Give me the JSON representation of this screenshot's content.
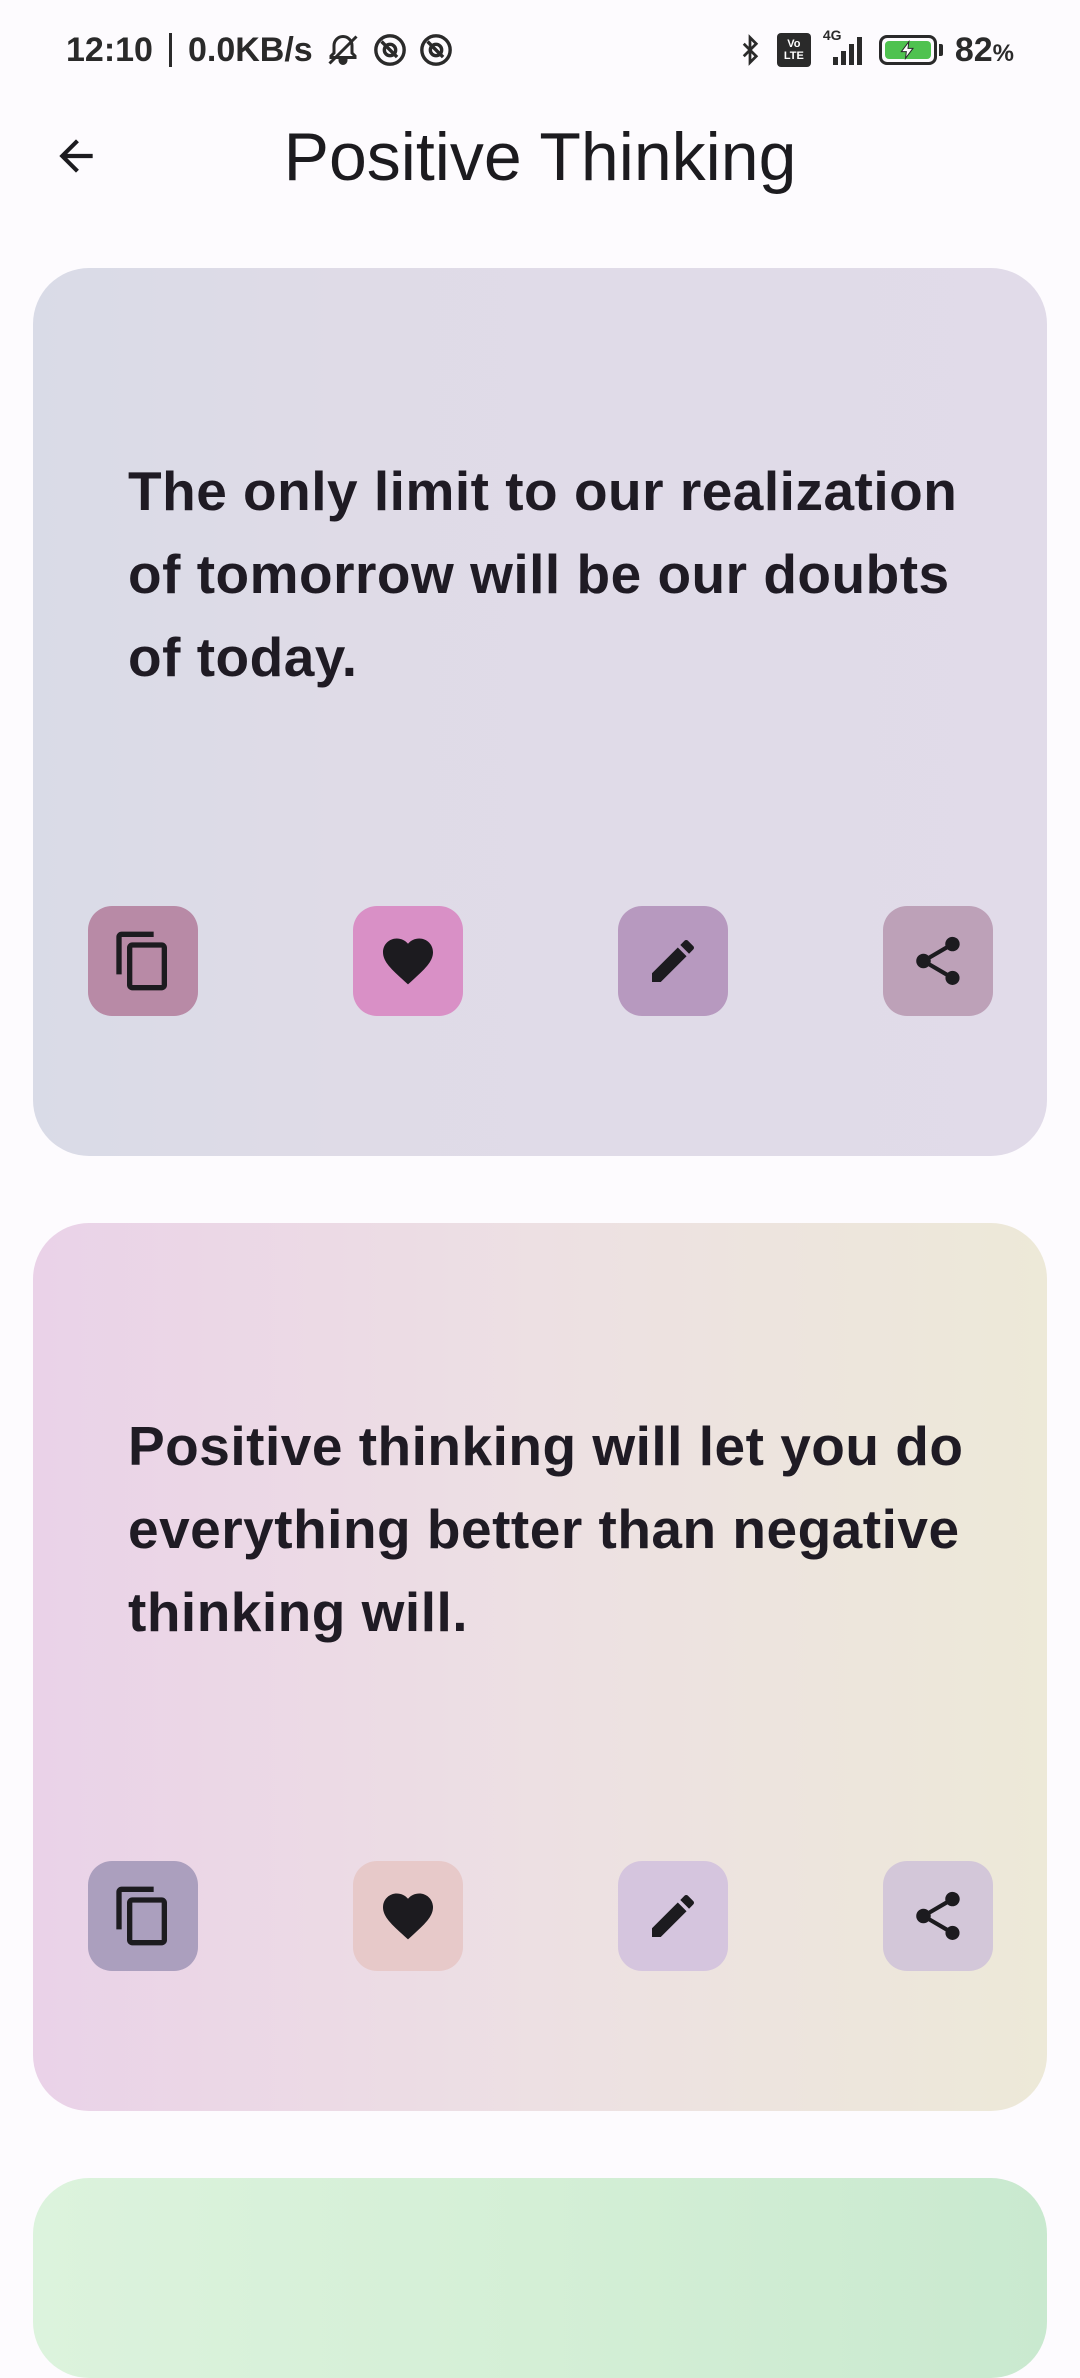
{
  "status_bar": {
    "time": "12:10",
    "network_speed": "0.0KB/s",
    "network_type": "4G",
    "volte_top": "Vo",
    "volte_bottom": "LTE",
    "battery_percent": "82",
    "battery_unit": "%",
    "icons": [
      "bell-muted-icon",
      "at-sign-icon",
      "at-sign-icon",
      "bluetooth-icon",
      "volte-icon",
      "signal-icon",
      "battery-charging-icon"
    ]
  },
  "app_bar": {
    "back_icon": "arrow-left-icon",
    "title": "Positive Thinking"
  },
  "cards": [
    {
      "quote": "The only limit to our realization of tomorrow will be our doubts of today.",
      "colors": {
        "copy": "#b88aa6",
        "favorite": "#d990c6",
        "edit": "#b799bf",
        "share": "#bda1b8"
      }
    },
    {
      "quote": "Positive thinking will let you do everything better than negative thinking will.",
      "colors": {
        "copy": "#ab9fbe",
        "favorite": "#e7c9c9",
        "edit": "#d5c5de",
        "share": "#d3c7d9"
      }
    },
    {
      "quote": ""
    }
  ],
  "action_icons": [
    "copy-icon",
    "heart-icon",
    "edit-icon",
    "share-icon"
  ]
}
